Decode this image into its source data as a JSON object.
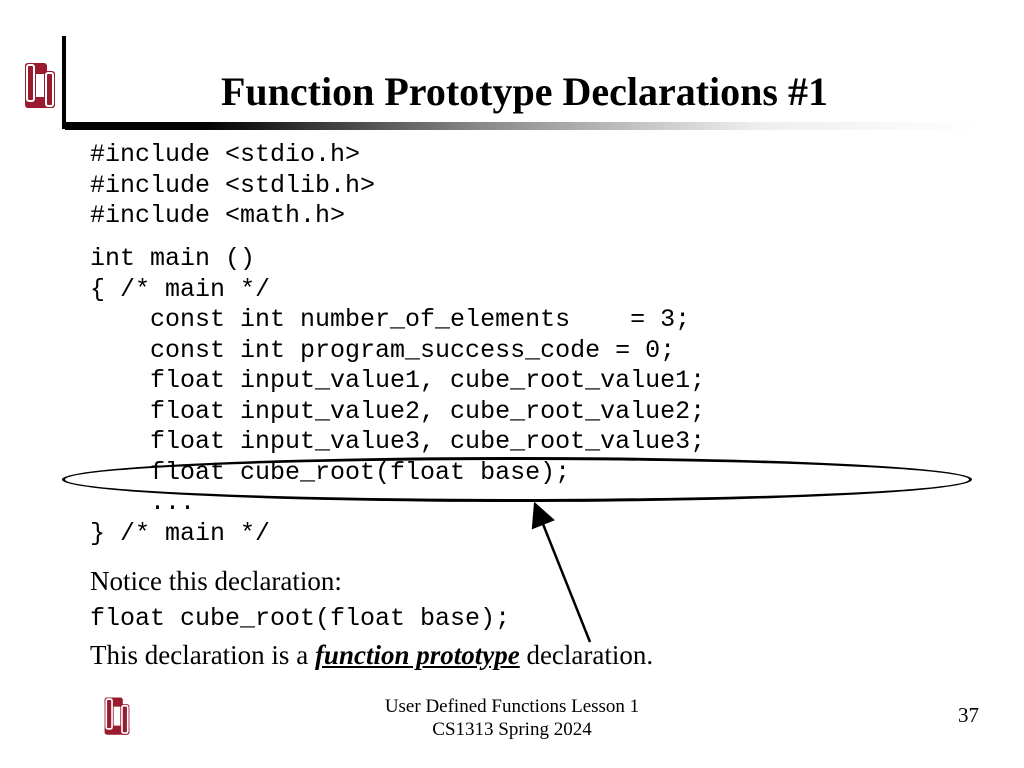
{
  "title": "Function Prototype Declarations #1",
  "code_block1": "#include <stdio.h>\n#include <stdlib.h>\n#include <math.h>",
  "code_block2": "int main ()\n{ /* main */\n    const int number_of_elements    = 3;\n    const int program_success_code = 0;\n    float input_value1, cube_root_value1;\n    float input_value2, cube_root_value2;\n    float input_value3, cube_root_value3;\n    float cube_root(float base);\n    ...\n} /* main */",
  "notice_text": "Notice this declaration:",
  "notice_code": "float cube_root(float base);",
  "proto_pre": "This declaration is a ",
  "proto_kw": "function prototype",
  "proto_post": " declaration.",
  "footer_line1": "User Defined Functions Lesson 1",
  "footer_line2": "CS1313 Spring 2024",
  "page_number": "37",
  "logo_color": "#9a1b2f"
}
